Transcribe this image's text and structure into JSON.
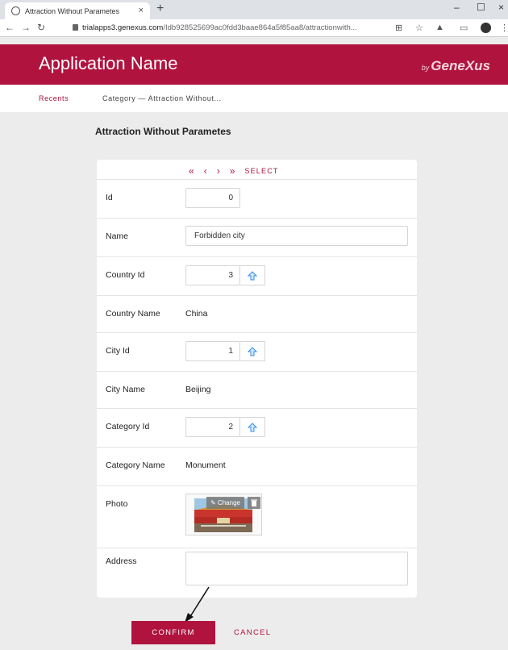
{
  "browser": {
    "tab_title": "Attraction Without Parametes",
    "tab_close": "×",
    "new_tab": "+",
    "url_host": "trialapps3.genexus.com",
    "url_path": "/Idb928525699ac0fdd3baae864a5f85aa8/attractionwith...",
    "window_minimize": "–",
    "window_maximize": "☐",
    "window_close": "×"
  },
  "app": {
    "name": "Application Name",
    "brand_prefix": "by",
    "brand_name": "GeneXus"
  },
  "breadcrumb": {
    "recents": "Recents",
    "current": "Category — Attraction Without..."
  },
  "form": {
    "title": "Attraction Without Parametes",
    "nav": {
      "first": "«",
      "prev": "‹",
      "next": "›",
      "last": "»",
      "select": "SELECT"
    },
    "fields": {
      "id": {
        "label": "Id",
        "value": "0"
      },
      "name": {
        "label": "Name",
        "value": "Forbidden city"
      },
      "country_id": {
        "label": "Country Id",
        "value": "3"
      },
      "country_name": {
        "label": "Country Name",
        "value": "China"
      },
      "city_id": {
        "label": "City Id",
        "value": "1"
      },
      "city_name": {
        "label": "City Name",
        "value": "Beijing"
      },
      "category_id": {
        "label": "Category Id",
        "value": "2"
      },
      "category_name": {
        "label": "Category Name",
        "value": "Monument"
      },
      "photo": {
        "label": "Photo",
        "change_label": "Change"
      },
      "address": {
        "label": "Address",
        "value": ""
      }
    }
  },
  "actions": {
    "confirm": "CONFIRM",
    "cancel": "CANCEL"
  },
  "colors": {
    "primary": "#b0133e",
    "background": "#ececec",
    "prompt_icon": "#3a8ee6"
  }
}
